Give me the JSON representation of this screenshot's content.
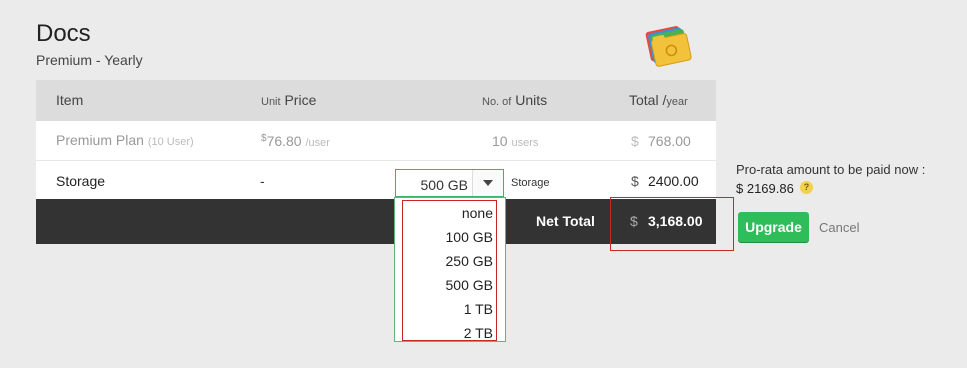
{
  "app": {
    "title": "Docs",
    "subtitle": "Premium - Yearly"
  },
  "table": {
    "headers": {
      "item": "Item",
      "unit_prefix": "Unit",
      "price": "Price",
      "units_prefix": "No. of",
      "units": "Units",
      "total": "Total /",
      "total_suffix": "year"
    },
    "plan_row": {
      "name": "Premium Plan",
      "users_note": "(10 User)",
      "price_currency": "$",
      "price": "76.80",
      "price_suffix": "/user",
      "units": "10",
      "units_suffix": "users",
      "total_currency": "$",
      "total": "768.00"
    },
    "storage_row": {
      "name": "Storage",
      "price": "-",
      "selected": "500 GB",
      "units_suffix": "Storage",
      "total_currency": "$",
      "total": "2400.00"
    },
    "net": {
      "label": "Net Total",
      "currency": "$",
      "value": "3,168.00"
    }
  },
  "dropdown": {
    "options": [
      "none",
      "100 GB",
      "250 GB",
      "500 GB",
      "1 TB",
      "2 TB"
    ]
  },
  "prorata": {
    "label": "Pro-rata amount to be paid now :",
    "amount": "$ 2169.86",
    "help": "?"
  },
  "actions": {
    "upgrade": "Upgrade",
    "cancel": "Cancel"
  },
  "colors": {
    "accent": "#2ebd59",
    "highlight": "#c62828",
    "dark_row": "#333333"
  }
}
